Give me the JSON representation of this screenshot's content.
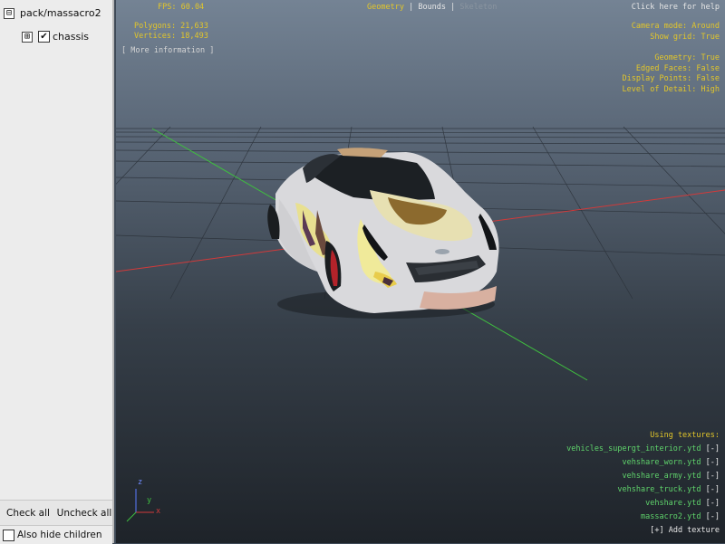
{
  "sidebar": {
    "root": {
      "label": "pack/massacro2",
      "expander": "⊟"
    },
    "child": {
      "label": "chassis",
      "expander": "⊞",
      "check": "✔"
    },
    "check_all": "Check all",
    "uncheck_all": "Uncheck all",
    "also_hide_children": "Also hide children"
  },
  "stats": {
    "fps": "FPS: 60.04",
    "polygons": "Polygons: 21,633",
    "vertices": "Vertices: 18,493",
    "more_info": "[ More information ]"
  },
  "tabs": {
    "geometry": "Geometry",
    "sep1": "|",
    "bounds": "Bounds",
    "sep2": "|",
    "skeleton": "Skeleton"
  },
  "help": "Click here for help",
  "settings": {
    "camera_mode": "Camera mode: Around",
    "show_grid": "Show grid: True",
    "geometry": "Geometry: True",
    "edged_faces": "Edged Faces: False",
    "display_points": "Display Points: False",
    "lod": "Level of Detail: High"
  },
  "textures": {
    "heading": "Using textures:",
    "remove": "[-]",
    "items": [
      "vehicles_supergt_interior.ytd",
      "vehshare_worn.ytd",
      "vehshare_army.ytd",
      "vehshare_truck.ytd",
      "vehshare.ytd",
      "massacro2.ytd"
    ],
    "add": "[+] Add texture"
  },
  "axes": {
    "x": "x",
    "y": "y",
    "z": "z"
  },
  "colors": {
    "overlay_yellow": "#e2c62a",
    "texture_green": "#5fd36b",
    "axis_red": "#d23a3a",
    "axis_green": "#3fbf3f"
  }
}
